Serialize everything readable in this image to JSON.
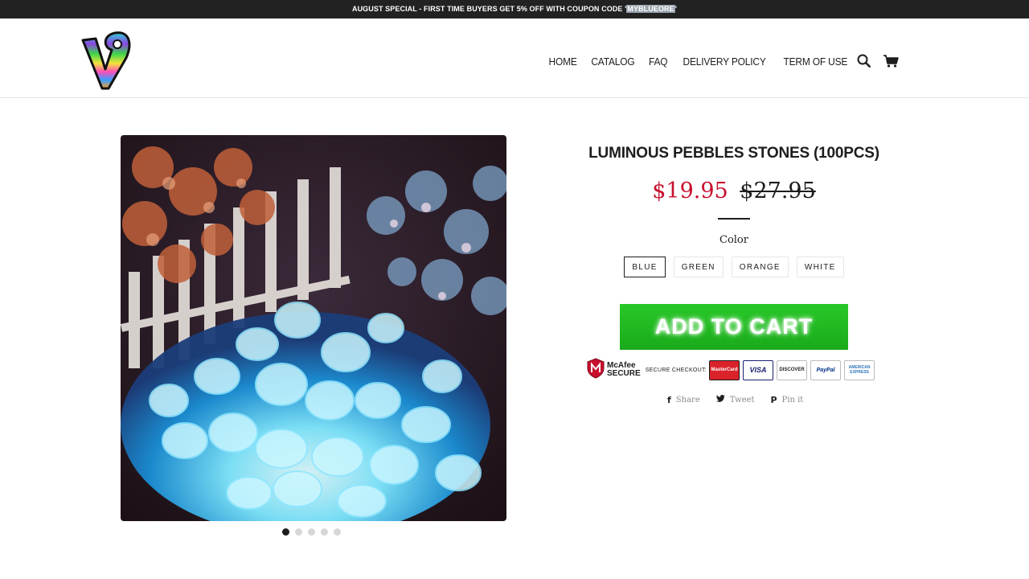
{
  "announcement": {
    "text": "AUGUST SPECIAL - FIRST TIME BUYERS GET 5% OFF WITH COUPON CODE '",
    "code": "MYBLUEORE",
    "suffix": "'"
  },
  "header": {
    "logo_icon": "rainbow-v9-logo",
    "nav": [
      {
        "label": "HOME"
      },
      {
        "label": "CATALOG"
      },
      {
        "label": "FAQ"
      },
      {
        "label": "DELIVERY POLICY"
      },
      {
        "label": "TERM OF USE"
      }
    ],
    "search_icon": "search-icon",
    "cart_icon": "cart-icon"
  },
  "product": {
    "title": "LUMINOUS PEBBLES STONES (100PCS)",
    "price": "$19.95",
    "compare_price": "$27.95",
    "color_label": "Color",
    "colors": [
      "BLUE",
      "GREEN",
      "ORANGE",
      "WHITE"
    ],
    "selected_color": "BLUE",
    "add_to_cart": "ADD TO CART",
    "gallery_count": 5,
    "gallery_active": 1
  },
  "trust": {
    "mcafee_line1": "McAfee",
    "mcafee_line2": "SECURE",
    "secure_checkout": "SECURE CHECKOUT:",
    "cards": [
      {
        "name": "MasterCard",
        "bg": "#d9222a",
        "fg": "#ffffff"
      },
      {
        "name": "VISA",
        "bg": "#ffffff",
        "fg": "#1a1f71"
      },
      {
        "name": "DISCOVER",
        "bg": "#ffffff",
        "fg": "#222222"
      },
      {
        "name": "PayPal",
        "bg": "#ffffff",
        "fg": "#003087"
      },
      {
        "name": "AMERICAN EXPRESS",
        "bg": "#ffffff",
        "fg": "#2e77bb"
      }
    ]
  },
  "share": {
    "share": "Share",
    "tweet": "Tweet",
    "pin": "Pin it"
  },
  "colors": {
    "sale_price": "#c8102e",
    "add_to_cart_bg": "#22bb22",
    "announcement_bg": "#222222"
  }
}
